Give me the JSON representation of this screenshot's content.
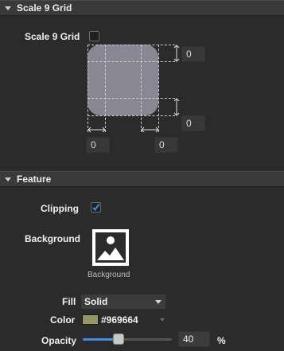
{
  "scale9": {
    "header": "Scale 9 Grid",
    "checkbox_label": "Scale 9 Grid",
    "checked": false,
    "top": "0",
    "bottom": "0",
    "left": "0",
    "right": "0"
  },
  "feature": {
    "header": "Feature",
    "clipping_label": "Clipping",
    "clipping_checked": true,
    "background_label": "Background",
    "background_thumb_caption": "Background",
    "fill_label": "Fill",
    "fill_value": "Solid",
    "color_label": "Color",
    "color_value": "#969664",
    "color_swatch": "#969664",
    "opacity_label": "Opacity",
    "opacity_value": "40",
    "opacity_unit": "%",
    "opacity_fraction": 0.4
  },
  "colors": {
    "accent": "#3f8ddd",
    "preview_fill": "#8a8794"
  },
  "icons": [
    "disclosure-triangle-icon",
    "checkmark-icon",
    "image-placeholder-icon",
    "dropdown-caret-icon"
  ]
}
